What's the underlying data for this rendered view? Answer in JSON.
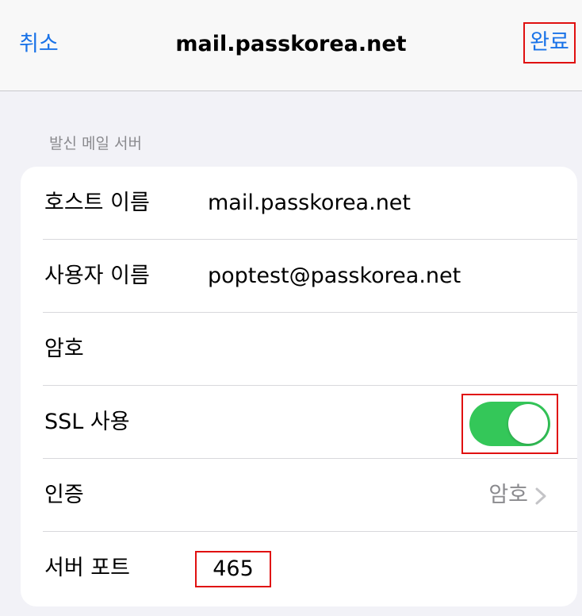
{
  "navbar": {
    "cancel_label": "취소",
    "title": "mail.passkorea.net",
    "done_label": "완료"
  },
  "section": {
    "header": "발신 메일 서버"
  },
  "rows": {
    "host": {
      "label": "호스트 이름",
      "value": "mail.passkorea.net"
    },
    "username": {
      "label": "사용자 이름",
      "value": "poptest@passkorea.net"
    },
    "password": {
      "label": "암호",
      "value": ""
    },
    "ssl": {
      "label": "SSL 사용",
      "enabled": true
    },
    "auth": {
      "label": "인증",
      "value": "암호"
    },
    "port": {
      "label": "서버 포트",
      "value": "465"
    }
  },
  "colors": {
    "accent": "#1a73e8",
    "toggle_on": "#34c759",
    "highlight_border": "#e01010",
    "secondary_text": "#8a8a8e"
  },
  "icons": {
    "auth_disclosure": "chevron-right-icon"
  }
}
